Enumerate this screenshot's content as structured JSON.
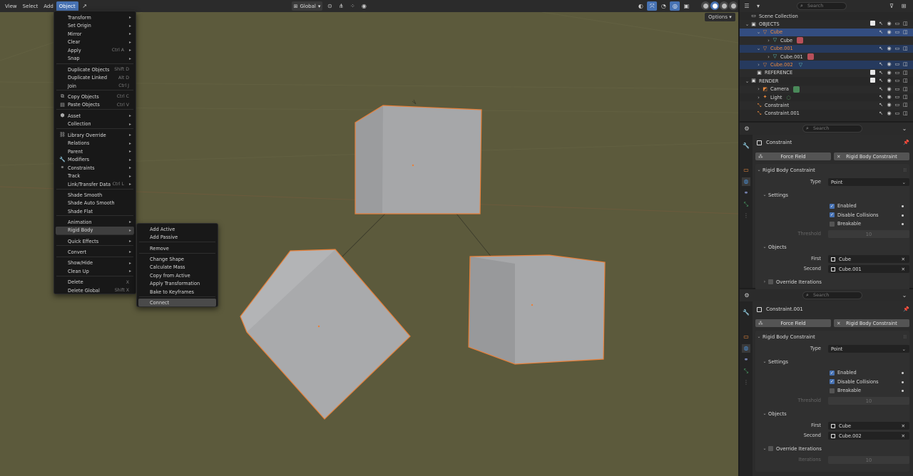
{
  "header": {
    "menus": [
      "View",
      "Select",
      "Add",
      "Object"
    ],
    "orientation": "Global",
    "options_label": "Options"
  },
  "object_menu": {
    "items": [
      {
        "label": "Transform",
        "arrow": true
      },
      {
        "label": "Set Origin",
        "arrow": true
      },
      {
        "label": "Mirror",
        "arrow": true
      },
      {
        "label": "Clear",
        "arrow": true
      },
      {
        "label": "Apply",
        "shortcut": "Ctrl A",
        "arrow": true
      },
      {
        "label": "Snap",
        "arrow": true
      },
      {
        "label": "Duplicate Objects",
        "shortcut": "Shift D"
      },
      {
        "label": "Duplicate Linked",
        "shortcut": "Alt D"
      },
      {
        "label": "Join",
        "shortcut": "Ctrl J"
      },
      {
        "label": "Copy Objects",
        "shortcut": "Ctrl C",
        "icon": "copy-icon"
      },
      {
        "label": "Paste Objects",
        "shortcut": "Ctrl V",
        "icon": "paste-icon"
      },
      {
        "label": "Asset",
        "arrow": true,
        "icon": "asset-icon"
      },
      {
        "label": "Collection",
        "arrow": true
      },
      {
        "label": "Library Override",
        "arrow": true,
        "icon": "library-override-icon"
      },
      {
        "label": "Relations",
        "arrow": true
      },
      {
        "label": "Parent",
        "arrow": true
      },
      {
        "label": "Modifiers",
        "arrow": true,
        "icon": "wrench-icon"
      },
      {
        "label": "Constraints",
        "arrow": true,
        "icon": "constraint-icon"
      },
      {
        "label": "Track",
        "arrow": true
      },
      {
        "label": "Link/Transfer Data",
        "shortcut": "Ctrl L",
        "arrow": true
      },
      {
        "label": "Shade Smooth"
      },
      {
        "label": "Shade Auto Smooth"
      },
      {
        "label": "Shade Flat"
      },
      {
        "label": "Animation",
        "arrow": true
      },
      {
        "label": "Rigid Body",
        "arrow": true
      },
      {
        "label": "Quick Effects",
        "arrow": true
      },
      {
        "label": "Convert",
        "arrow": true
      },
      {
        "label": "Show/Hide",
        "arrow": true
      },
      {
        "label": "Clean Up",
        "arrow": true
      },
      {
        "label": "Delete",
        "shortcut": "X"
      },
      {
        "label": "Delete Global",
        "shortcut": "Shift X"
      }
    ]
  },
  "rigid_body_menu": {
    "items": [
      "Add Active",
      "Add Passive",
      "Remove",
      "Change Shape",
      "Calculate Mass",
      "Copy from Active",
      "Apply Transformation",
      "Bake to Keyframes",
      "Connect"
    ]
  },
  "outliner": {
    "search_placeholder": "Search",
    "rows": [
      {
        "label": "Scene Collection"
      },
      {
        "label": "OBJECTS"
      },
      {
        "label": "Cube"
      },
      {
        "label": "Cube"
      },
      {
        "label": "Cube.001"
      },
      {
        "label": "Cube.001"
      },
      {
        "label": "Cube.002"
      },
      {
        "label": "REFERENCE"
      },
      {
        "label": "RENDER"
      },
      {
        "label": "Camera"
      },
      {
        "label": "Light"
      },
      {
        "label": "Constraint"
      },
      {
        "label": "Constraint.001"
      }
    ]
  },
  "props": [
    {
      "search_placeholder": "Search",
      "object_name": "Constraint",
      "force_field": "Force Field",
      "rbc_button": "Rigid Body Constraint",
      "panel_title": "Rigid Body Constraint",
      "type_label": "Type",
      "type_value": "Point",
      "settings_label": "Settings",
      "enabled_label": "Enabled",
      "enabled": true,
      "disable_collisions_label": "Disable Collisions",
      "disable_collisions": true,
      "breakable_label": "Breakable",
      "breakable": false,
      "threshold_label": "Threshold",
      "threshold_value": "10",
      "objects_label": "Objects",
      "first_label": "First",
      "first_value": "Cube",
      "second_label": "Second",
      "second_value": "Cube.001",
      "override_label": "Override Iterations"
    },
    {
      "search_placeholder": "Search",
      "object_name": "Constraint.001",
      "force_field": "Force Field",
      "rbc_button": "Rigid Body Constraint",
      "panel_title": "Rigid Body Constraint",
      "type_label": "Type",
      "type_value": "Point",
      "settings_label": "Settings",
      "enabled_label": "Enabled",
      "enabled": true,
      "disable_collisions_label": "Disable Collisions",
      "disable_collisions": true,
      "breakable_label": "Breakable",
      "breakable": false,
      "threshold_label": "Threshold",
      "threshold_value": "10",
      "objects_label": "Objects",
      "first_label": "First",
      "first_value": "Cube",
      "second_label": "Second",
      "second_value": "Cube.002",
      "override_label": "Override Iterations",
      "iterations_label": "Iterations",
      "iterations_value": "10"
    }
  ],
  "colors": {
    "viewport_bg": "#5c5a3c",
    "selection_outline": "#e8803a",
    "accent_blue": "#4772b3",
    "cube_face": "#a5a6a8"
  }
}
